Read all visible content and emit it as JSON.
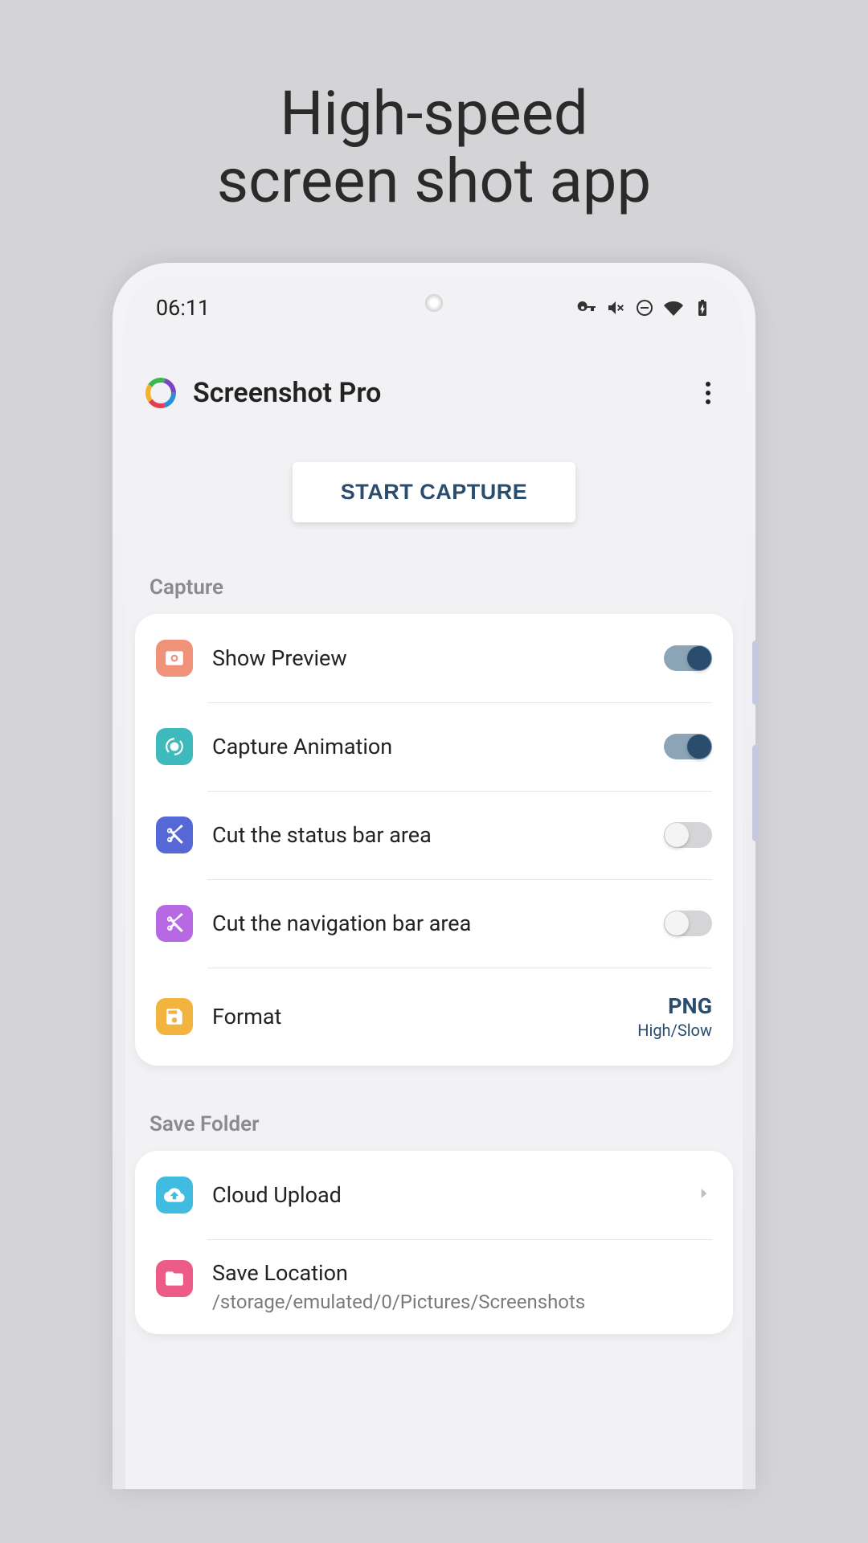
{
  "marketing": {
    "line1": "High-speed",
    "line2": "screen shot app"
  },
  "statusbar": {
    "time": "06:11"
  },
  "header": {
    "app_title": "Screenshot Pro"
  },
  "main_button": {
    "label": "START CAPTURE"
  },
  "sections": {
    "capture": {
      "title": "Capture",
      "items": [
        {
          "label": "Show Preview",
          "icon": "preview-icon",
          "icon_bg": "#f09179",
          "toggle_on": true
        },
        {
          "label": "Capture Animation",
          "icon": "animation-icon",
          "icon_bg": "#3fbabc",
          "toggle_on": true
        },
        {
          "label": "Cut the status bar area",
          "icon": "scissors-icon",
          "icon_bg": "#5568d6",
          "toggle_on": false
        },
        {
          "label": "Cut the navigation bar area",
          "icon": "scissors-icon",
          "icon_bg": "#b768e3",
          "toggle_on": false
        },
        {
          "label": "Format",
          "icon": "file-icon",
          "icon_bg": "#f2b33f",
          "value": "PNG",
          "subvalue": "High/Slow"
        }
      ]
    },
    "save_folder": {
      "title": "Save Folder",
      "items": [
        {
          "label": "Cloud Upload",
          "icon": "cloud-upload-icon",
          "icon_bg": "#3fbce0",
          "chevron": true
        },
        {
          "label": "Save Location",
          "icon": "folder-icon",
          "icon_bg": "#ed5b88",
          "subtitle": "/storage/emulated/0/Pictures/Screenshots"
        }
      ]
    }
  }
}
